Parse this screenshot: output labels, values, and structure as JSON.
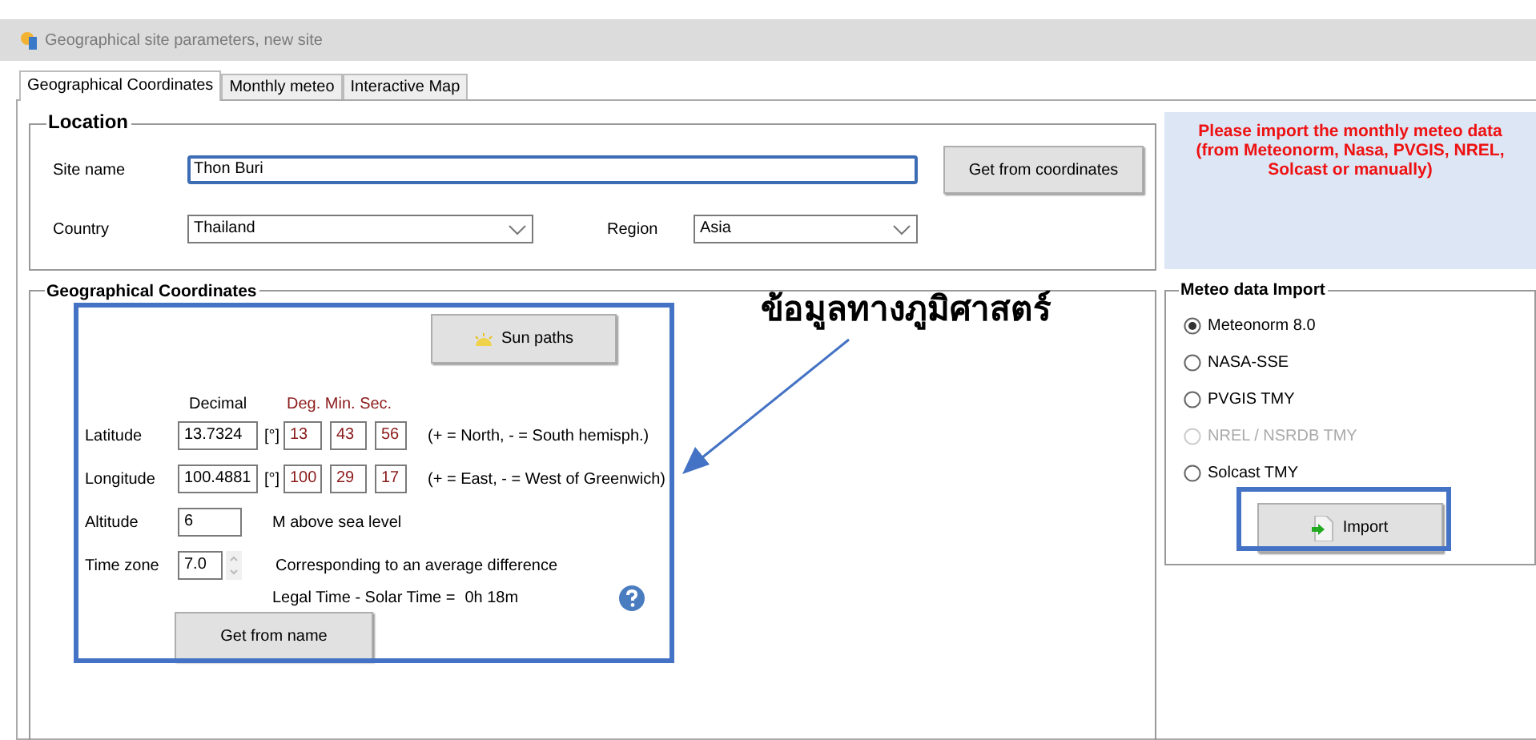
{
  "window": {
    "title": "Geographical site parameters, new site"
  },
  "tabs": [
    {
      "label": "Geographical Coordinates",
      "selected": true
    },
    {
      "label": "Monthly meteo",
      "selected": false
    },
    {
      "label": "Interactive Map",
      "selected": false
    }
  ],
  "location": {
    "title": "Location",
    "site_name_label": "Site name",
    "site_name": "Thon Buri",
    "country_label": "Country",
    "country": "Thailand",
    "region_label": "Region",
    "region": "Asia",
    "button": "Get from coordinates"
  },
  "notice": "Please import the monthly meteo data (from Meteonorm, Nasa, PVGIS, NREL, Solcast or manually)",
  "coordinates": {
    "title": "Geographical Coordinates",
    "sun_paths_button": "Sun paths",
    "decimal_header": "Decimal",
    "dms_header": "Deg. Min. Sec.",
    "rows": [
      {
        "label": "Latitude",
        "decimal": "13.7324",
        "unit": "[°]",
        "deg": "13",
        "min": "43",
        "sec": "56",
        "note": "(+ = North, - = South hemisph.)"
      },
      {
        "label": "Longitude",
        "decimal": "100.4881",
        "unit": "[°]",
        "deg": "100",
        "min": "29",
        "sec": "17",
        "note": "(+ = East, - = West of Greenwich)"
      }
    ],
    "altitude_label": "Altitude",
    "altitude": "6",
    "altitude_note": "M above sea level",
    "timezone_label": "Time zone",
    "timezone": "7.0",
    "timezone_note": "Corresponding to an average difference",
    "legal_time_label": "Legal Time - Solar Time =",
    "legal_time": "0h 18m",
    "name_button": "Get from name"
  },
  "meteo_import": {
    "title": "Meteo data Import",
    "options": [
      {
        "label": "Meteonorm 8.0",
        "selected": true,
        "disabled": false
      },
      {
        "label": "NASA-SSE",
        "selected": false,
        "disabled": false
      },
      {
        "label": "PVGIS TMY",
        "selected": false,
        "disabled": false
      },
      {
        "label": "NREL / NSRDB TMY",
        "selected": false,
        "disabled": true
      },
      {
        "label": "Solcast TMY",
        "selected": false,
        "disabled": false
      }
    ],
    "button": "Import"
  },
  "annotation": {
    "text": "ข้อมูลทางภูมิศาสตร์"
  }
}
